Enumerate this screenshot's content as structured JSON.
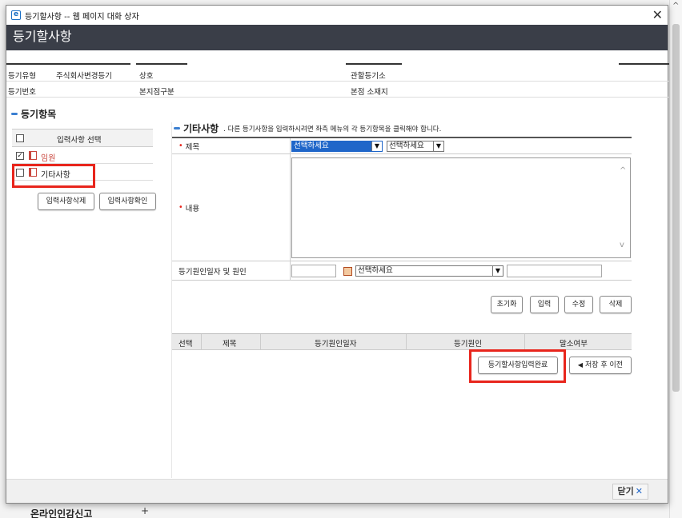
{
  "window": {
    "title": "등기할사항 -- 웹 페이지 대화 상자"
  },
  "header": {
    "title": "등기할사항"
  },
  "info": {
    "row1": {
      "label1": "등기유형",
      "value1": "주식회사변경등기",
      "label2": "상호",
      "label3": "관할등기소"
    },
    "row2": {
      "label1": "등기번호",
      "label2": "본지점구분",
      "label3": "본점 소재지"
    }
  },
  "left": {
    "section_title": "등기항목",
    "table_header": "입력사항 선택",
    "items": [
      {
        "label": "임원",
        "checked": true
      },
      {
        "label": "기타사항",
        "checked": false
      }
    ],
    "delete_button": "입력사항삭제",
    "confirm_button": "입력사항확인"
  },
  "right": {
    "section_title": "기타사항",
    "instruction": ". 다른 등기사항을 입력하시려면 좌측 메뉴의 각 등기항목을 클릭해야 합니다.",
    "fields": {
      "title_label": "제목",
      "title_select1": "선택하세요",
      "title_select2": "선택하세요",
      "content_label": "내용",
      "cause_label": "등기원인일자 및 원인",
      "cause_select": "선택하세요"
    },
    "buttons": {
      "reset": "초기화",
      "input": "입력",
      "edit": "수정",
      "delete": "삭제"
    },
    "grid_columns": [
      "선택",
      "제목",
      "등기원인일자",
      "등기원인",
      "말소여부"
    ],
    "complete_button": "등기할사항입력완료",
    "save_prev_button": "저장 후 이전"
  },
  "footer": {
    "close_label": "닫기"
  },
  "background": {
    "menu_item": "온라인인감신고",
    "plus": "+"
  },
  "colors": {
    "header_bg": "#3a3e48",
    "accent_blue": "#1f66c9",
    "highlight_red": "#e8251c"
  }
}
